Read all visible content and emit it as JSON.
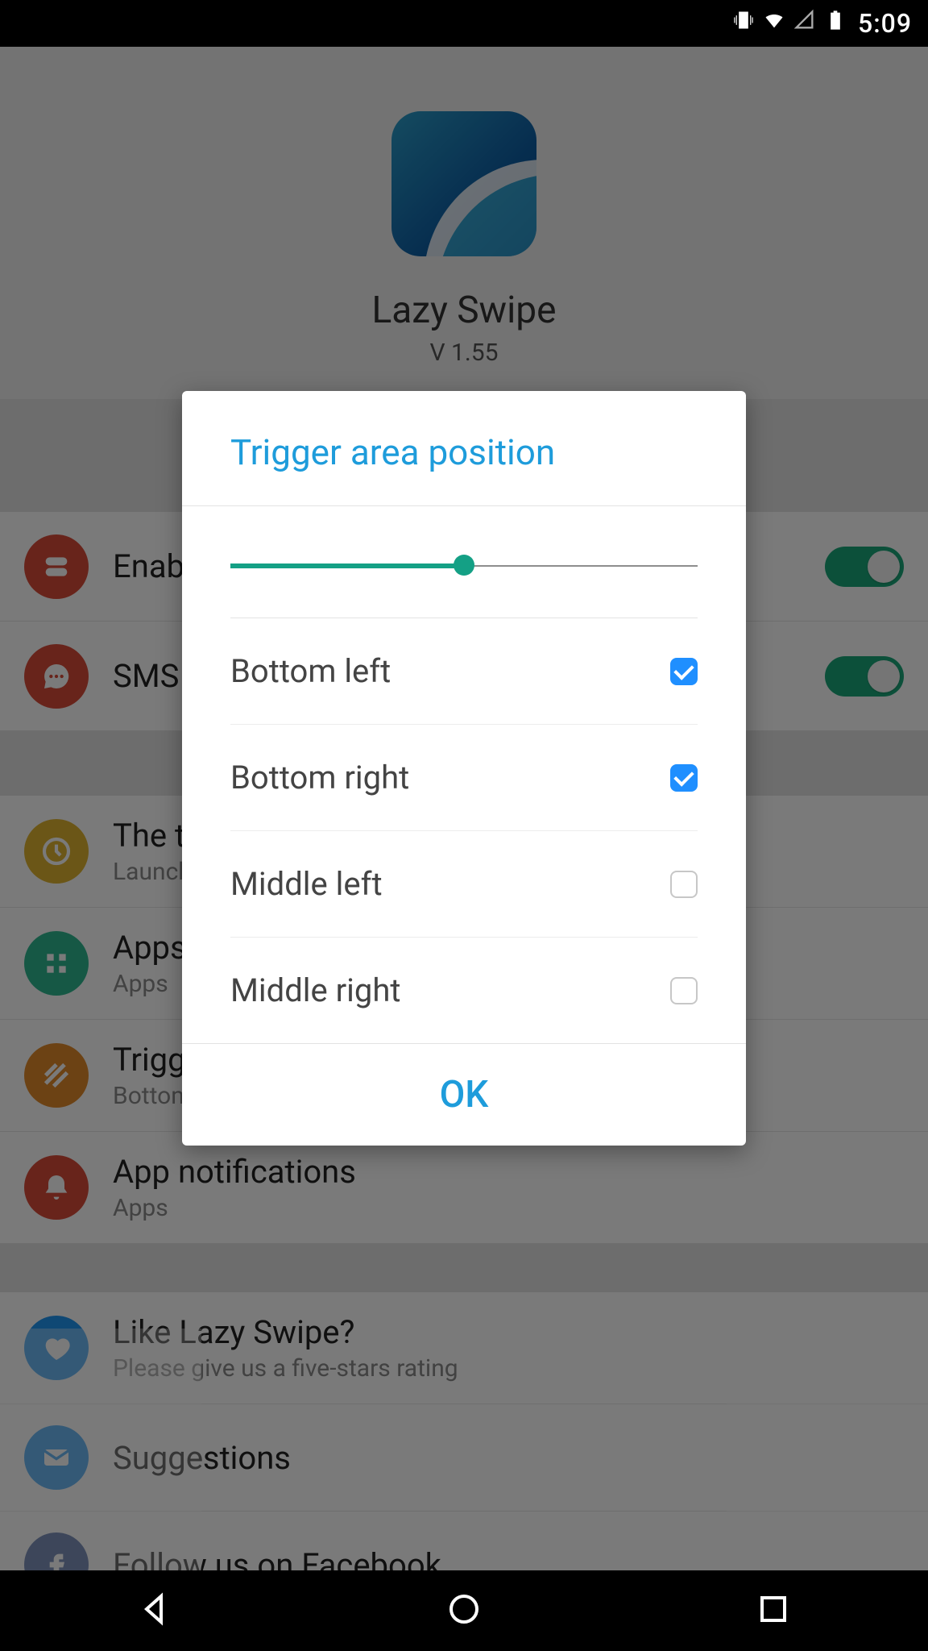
{
  "status": {
    "time": "5:09"
  },
  "app": {
    "name": "Lazy Swipe",
    "version": "V 1.55"
  },
  "settings": {
    "enable": {
      "title": "Enable",
      "icon": "toggle-icon",
      "icon_color": "icon-red",
      "toggle": true
    },
    "sms": {
      "title": "SMS",
      "icon": "chat-icon",
      "icon_color": "icon-red",
      "toggle": true
    },
    "theme": {
      "title": "The theme",
      "sub": "Launch",
      "icon": "clock-icon",
      "icon_color": "icon-yellow"
    },
    "apps": {
      "title": "Apps",
      "sub": "Apps",
      "icon": "grid-icon",
      "icon_color": "icon-green"
    },
    "trigger": {
      "title": "Trigger area position",
      "sub": "Bottom",
      "icon": "hatch-icon",
      "icon_color": "icon-orange"
    },
    "notif": {
      "title": "App notifications",
      "sub": "Apps",
      "icon": "bell-icon",
      "icon_color": "icon-red"
    }
  },
  "about": {
    "like": {
      "title": "Like Lazy Swipe?",
      "sub": "Please give us a five-stars rating",
      "icon": "heart-icon",
      "icon_color": "icon-blue"
    },
    "suggest": {
      "title": "Suggestions",
      "icon": "mail-icon",
      "icon_color": "icon-blue"
    },
    "facebook": {
      "title": "Follow us on Facebook",
      "icon": "facebook-icon",
      "icon_color": "icon-fb"
    }
  },
  "dialog": {
    "title": "Trigger area position",
    "slider_value": 50,
    "options": [
      {
        "label": "Bottom left",
        "checked": true
      },
      {
        "label": "Bottom right",
        "checked": true
      },
      {
        "label": "Middle left",
        "checked": false
      },
      {
        "label": "Middle right",
        "checked": false
      }
    ],
    "ok_label": "OK"
  }
}
